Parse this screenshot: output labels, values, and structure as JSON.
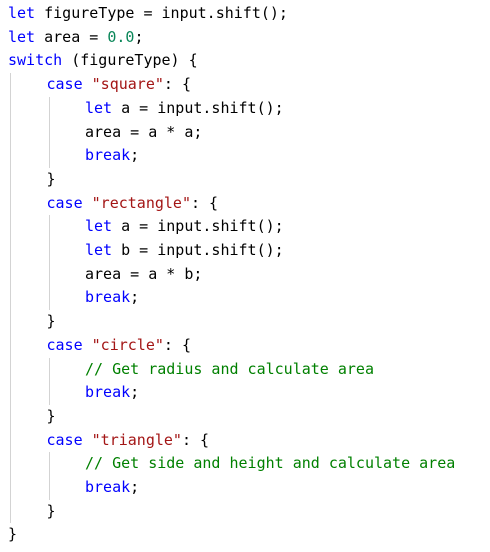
{
  "colors": {
    "background": "#ffffff",
    "keyword": "#0000ff",
    "string": "#a31515",
    "number": "#098658",
    "comment": "#008000",
    "plain": "#000000",
    "indent_guide": "#d3d3d3"
  },
  "code": {
    "language": "javascript",
    "lines": [
      {
        "indent": 0,
        "tokens": [
          {
            "t": "keyword",
            "v": "let"
          },
          {
            "t": "plain",
            "v": " figureType = input.shift();"
          }
        ]
      },
      {
        "indent": 0,
        "tokens": [
          {
            "t": "keyword",
            "v": "let"
          },
          {
            "t": "plain",
            "v": " area = "
          },
          {
            "t": "number",
            "v": "0.0"
          },
          {
            "t": "plain",
            "v": ";"
          }
        ]
      },
      {
        "indent": 0,
        "tokens": [
          {
            "t": "keyword",
            "v": "switch"
          },
          {
            "t": "plain",
            "v": " (figureType) {"
          }
        ]
      },
      {
        "indent": 1,
        "tokens": [
          {
            "t": "keyword",
            "v": "case"
          },
          {
            "t": "plain",
            "v": " "
          },
          {
            "t": "string",
            "v": "\"square\""
          },
          {
            "t": "plain",
            "v": ": {"
          }
        ]
      },
      {
        "indent": 2,
        "tokens": [
          {
            "t": "keyword",
            "v": "let"
          },
          {
            "t": "plain",
            "v": " a = input.shift();"
          }
        ]
      },
      {
        "indent": 2,
        "tokens": [
          {
            "t": "plain",
            "v": "area = a * a;"
          }
        ]
      },
      {
        "indent": 2,
        "tokens": [
          {
            "t": "keyword",
            "v": "break"
          },
          {
            "t": "plain",
            "v": ";"
          }
        ]
      },
      {
        "indent": 1,
        "tokens": [
          {
            "t": "plain",
            "v": "}"
          }
        ]
      },
      {
        "indent": 1,
        "tokens": [
          {
            "t": "keyword",
            "v": "case"
          },
          {
            "t": "plain",
            "v": " "
          },
          {
            "t": "string",
            "v": "\"rectangle\""
          },
          {
            "t": "plain",
            "v": ": {"
          }
        ]
      },
      {
        "indent": 2,
        "tokens": [
          {
            "t": "keyword",
            "v": "let"
          },
          {
            "t": "plain",
            "v": " a = input.shift();"
          }
        ]
      },
      {
        "indent": 2,
        "tokens": [
          {
            "t": "keyword",
            "v": "let"
          },
          {
            "t": "plain",
            "v": " b = input.shift();"
          }
        ]
      },
      {
        "indent": 2,
        "tokens": [
          {
            "t": "plain",
            "v": "area = a * b;"
          }
        ]
      },
      {
        "indent": 2,
        "tokens": [
          {
            "t": "keyword",
            "v": "break"
          },
          {
            "t": "plain",
            "v": ";"
          }
        ]
      },
      {
        "indent": 1,
        "tokens": [
          {
            "t": "plain",
            "v": "}"
          }
        ]
      },
      {
        "indent": 1,
        "tokens": [
          {
            "t": "keyword",
            "v": "case"
          },
          {
            "t": "plain",
            "v": " "
          },
          {
            "t": "string",
            "v": "\"circle\""
          },
          {
            "t": "plain",
            "v": ": {"
          }
        ]
      },
      {
        "indent": 2,
        "tokens": [
          {
            "t": "comment",
            "v": "// Get radius and calculate area"
          }
        ]
      },
      {
        "indent": 2,
        "tokens": [
          {
            "t": "keyword",
            "v": "break"
          },
          {
            "t": "plain",
            "v": ";"
          }
        ]
      },
      {
        "indent": 1,
        "tokens": [
          {
            "t": "plain",
            "v": "}"
          }
        ]
      },
      {
        "indent": 1,
        "tokens": [
          {
            "t": "keyword",
            "v": "case"
          },
          {
            "t": "plain",
            "v": " "
          },
          {
            "t": "string",
            "v": "\"triangle\""
          },
          {
            "t": "plain",
            "v": ": {"
          }
        ]
      },
      {
        "indent": 2,
        "tokens": [
          {
            "t": "comment",
            "v": "// Get side and height and calculate area"
          }
        ]
      },
      {
        "indent": 2,
        "tokens": [
          {
            "t": "keyword",
            "v": "break"
          },
          {
            "t": "plain",
            "v": ";"
          }
        ]
      },
      {
        "indent": 1,
        "tokens": [
          {
            "t": "plain",
            "v": "}"
          }
        ]
      },
      {
        "indent": 0,
        "tokens": [
          {
            "t": "plain",
            "v": "}"
          }
        ]
      }
    ]
  }
}
